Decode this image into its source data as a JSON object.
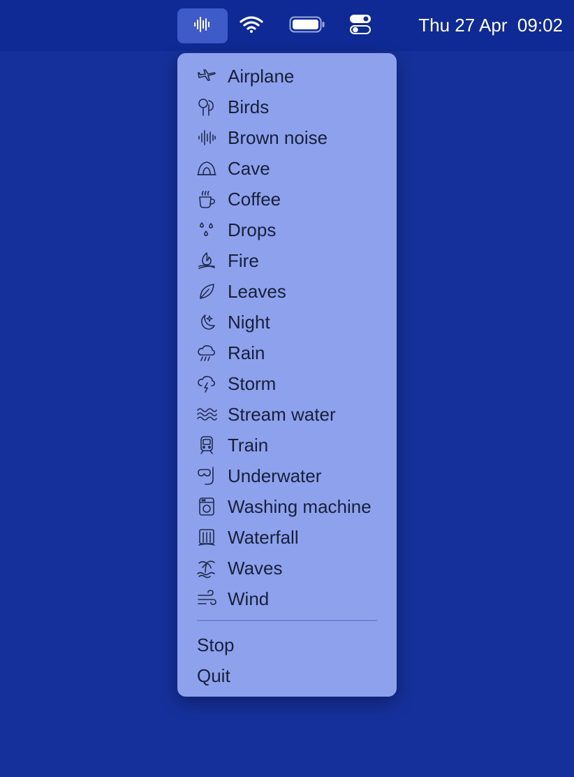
{
  "menubar": {
    "clock": "Thu 27 Apr  09:02",
    "icons": [
      "waveform-icon",
      "wifi-icon",
      "battery-icon",
      "control-center-icon"
    ]
  },
  "menu": {
    "items": [
      {
        "label": "Airplane",
        "icon": "airplane-icon"
      },
      {
        "label": "Birds",
        "icon": "trees-icon"
      },
      {
        "label": "Brown noise",
        "icon": "waveform-icon"
      },
      {
        "label": "Cave",
        "icon": "cave-icon"
      },
      {
        "label": "Coffee",
        "icon": "coffee-cup-icon"
      },
      {
        "label": "Drops",
        "icon": "drops-icon"
      },
      {
        "label": "Fire",
        "icon": "fire-icon"
      },
      {
        "label": "Leaves",
        "icon": "leaf-icon"
      },
      {
        "label": "Night",
        "icon": "moon-stars-icon"
      },
      {
        "label": "Rain",
        "icon": "cloud-rain-icon"
      },
      {
        "label": "Storm",
        "icon": "cloud-bolt-icon"
      },
      {
        "label": "Stream water",
        "icon": "water-waves-icon"
      },
      {
        "label": "Train",
        "icon": "train-icon"
      },
      {
        "label": "Underwater",
        "icon": "snorkel-icon"
      },
      {
        "label": "Washing machine",
        "icon": "washing-machine-icon"
      },
      {
        "label": "Waterfall",
        "icon": "waterfall-icon"
      },
      {
        "label": "Waves",
        "icon": "palm-waves-icon"
      },
      {
        "label": "Wind",
        "icon": "wind-icon"
      }
    ],
    "actions": {
      "stop_label": "Stop",
      "quit_label": "Quit"
    }
  },
  "colors": {
    "desktop": "#15309a",
    "menubar": "#0f2a94",
    "menu_background": "#8ea1ec",
    "menu_text": "#17203b"
  }
}
